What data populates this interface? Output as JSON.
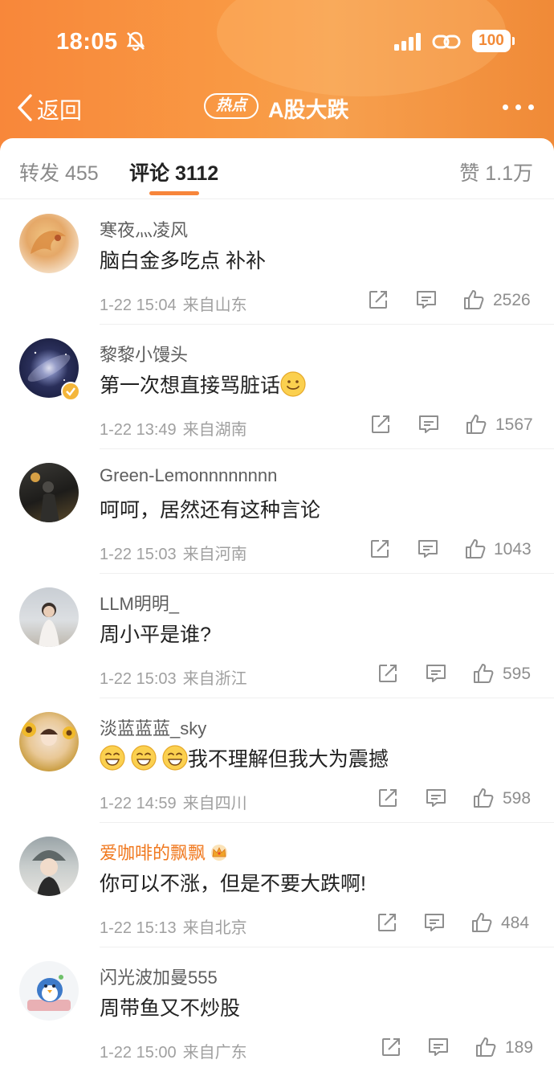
{
  "status_bar": {
    "time": "18:05",
    "battery": "100"
  },
  "nav": {
    "back_label": "返回",
    "hot_badge": "热点",
    "title": "A股大跌"
  },
  "tabs": [
    {
      "label": "转发 455"
    },
    {
      "label": "评论 3112",
      "active": true
    },
    {
      "label": "赞 1.1万"
    }
  ],
  "accent_color": "#f7853a",
  "comments": [
    {
      "username": "寒夜灬凌风",
      "content": "脑白金多吃点 补补",
      "date": "1-22 15:04",
      "location": "来自山东",
      "likes": "2526"
    },
    {
      "username": "黎黎小馒头",
      "content": "第一次想直接骂脏话",
      "content_emoji": "smile-emoji",
      "verified": true,
      "date": "1-22 13:49",
      "location": "来自湖南",
      "likes": "1567"
    },
    {
      "username": "Green-Lemonnnnnnnn",
      "content": "呵呵，居然还有这种言论",
      "date": "1-22 15:03",
      "location": "来自河南",
      "likes": "1043"
    },
    {
      "username": "LLM明明_",
      "content": "周小平是谁?",
      "date": "1-22 15:03",
      "location": "来自浙江",
      "likes": "595"
    },
    {
      "username": "淡蓝蓝蓝_sky",
      "content": "我不理解但我大为震撼",
      "content_prefix_emoji": [
        "grin-emoji",
        "grin-emoji",
        "grin-emoji"
      ],
      "date": "1-22 14:59",
      "location": "来自四川",
      "likes": "598"
    },
    {
      "username": "爱咖啡的飘飘",
      "content": "你可以不涨，但是不要大跌啊!",
      "vip": true,
      "date": "1-22 15:13",
      "location": "来自北京",
      "likes": "484"
    },
    {
      "username": "闪光波加曼555",
      "content": "周带鱼又不炒股",
      "date": "1-22 15:00",
      "location": "来自广东",
      "likes": "189"
    }
  ]
}
